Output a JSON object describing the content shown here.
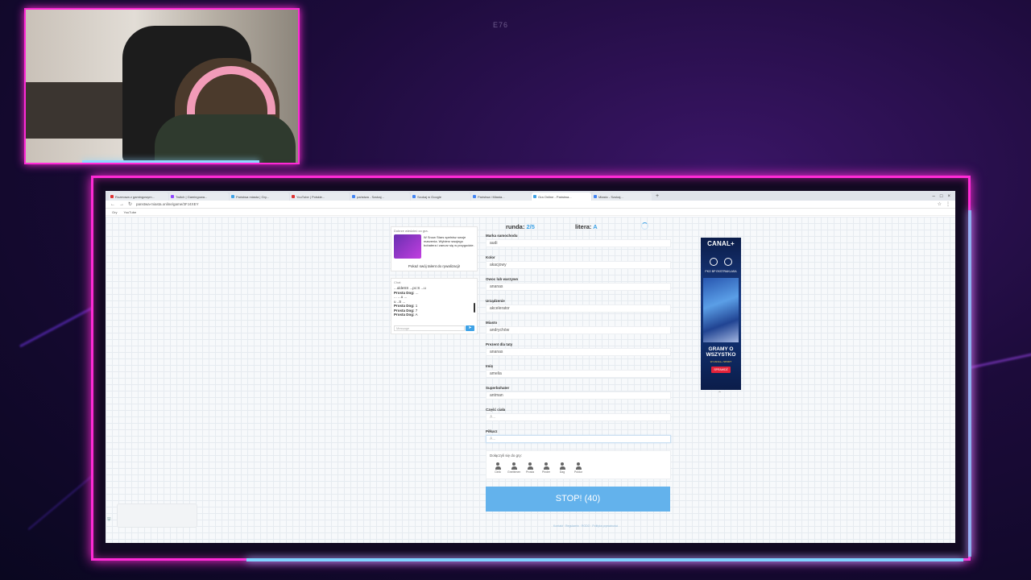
{
  "overlay": {
    "code": "E76"
  },
  "browser": {
    "tabs": [
      {
        "label": "Rozmowa z gamingowym..."
      },
      {
        "label": "Twitch | Gamingowa..."
      },
      {
        "label": "Państwa miasta | Gry..."
      },
      {
        "label": "YouTube | Polskie..."
      },
      {
        "label": "państwa - Szukaj..."
      },
      {
        "label": "Szukaj w Google"
      },
      {
        "label": "Państwa i Miasta..."
      },
      {
        "label": "Gra Online - Państwa..."
      },
      {
        "label": "Miasto - Szukaj..."
      }
    ],
    "url": "panstwa-miasta.online/game/3FJ4XEY",
    "bookmarks": [
      "Gry",
      "YouTube"
    ]
  },
  "ad": {
    "header": "Dobrze wiedzieć co gra.",
    "text": "W Snow Stars spełnisz swoje marzenia. Wybierz swojego bohatera i zanurz się w przygodzie.",
    "link": "Pokaż swój talent do rywalizacji!"
  },
  "chat": {
    "title": "Chat",
    "lines": [
      {
        "name": "",
        "text": "...uldeSS ...pc:S ...u"
      },
      {
        "name": "Prosta Dog:",
        "text": "..."
      },
      {
        "name": "",
        "text": "... ...u ..."
      },
      {
        "name": "",
        "text": "u ..S ..."
      },
      {
        "name": "Prosta Dog:",
        "text": "1"
      },
      {
        "name": "Prosta Dog:",
        "text": "7"
      },
      {
        "name": "Prosta Dog:",
        "text": "A"
      }
    ],
    "placeholder": "Message",
    "send_icon": "send-icon"
  },
  "game": {
    "round_label": "runda:",
    "round_value": "2/5",
    "letter_label": "litera:",
    "letter_value": "A",
    "fields": [
      {
        "label": "Marka samochodu",
        "value": "audi"
      },
      {
        "label": "Kolor",
        "value": "akacjowy"
      },
      {
        "label": "Owoc lub warzywo",
        "value": "ananas"
      },
      {
        "label": "Urządzenie",
        "value": "akcelerator"
      },
      {
        "label": "Miasto",
        "value": "andrychów"
      },
      {
        "label": "Prezent dla taty",
        "value": "ananas"
      },
      {
        "label": "Imię",
        "value": "amelia"
      },
      {
        "label": "Superbohater",
        "value": "antman"
      },
      {
        "label": "Część ciała",
        "value": "",
        "placeholder": "A..."
      },
      {
        "label": "Piłkarz",
        "value": "",
        "placeholder": "A..."
      }
    ],
    "join_text": "Dołączyli się do gry:",
    "players": [
      "Cinik",
      "Gnebtmen",
      "Prosta",
      "Pinder",
      "Dag",
      "Poldur"
    ],
    "stop_label": "STOP! (40)",
    "footer": "Kontakt · Regulamin · RODO · Polityka prywatności"
  },
  "banner": {
    "brand": "CANAL+",
    "league": "PKO BP EKSTRAKLASA",
    "slogan": "GRAMY O WSZYSTKO",
    "sub": "W CANAL+ SPORT",
    "cta": "SPRAWDŹ",
    "colors": {
      "bg": "#0b1d4a",
      "cta": "#e4233a"
    }
  },
  "colors": {
    "accent": "#3ea2e6",
    "stop_button": "#63b2ec",
    "neon_pink": "#ff2bd6",
    "neon_cyan": "#7fd3ff"
  }
}
